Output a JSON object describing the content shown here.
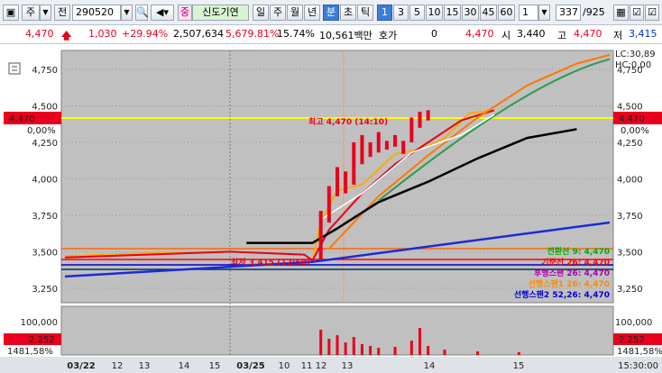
{
  "toolbar": {
    "market_label": "주",
    "jeon_label": "전",
    "stock_code": "290520",
    "stock_name": "신도기연",
    "stock_badge": "중",
    "period_tabs": [
      "일",
      "주",
      "월",
      "년",
      "분",
      "초",
      "틱"
    ],
    "selected_period": "분",
    "intervals": [
      "1",
      "3",
      "5",
      "10",
      "15",
      "30",
      "45",
      "60"
    ],
    "selected_interval": "1",
    "count_value": "1",
    "page_counter": "337",
    "page_total": "/925"
  },
  "quote": {
    "price": "4,470",
    "change": "1,030",
    "change_pct": "+29.94%",
    "volume": "2,507,634",
    "volume_pct": "5,679.81%",
    "turnover_pct": "15.74%",
    "amount": "10,561백만",
    "hoga_label": "호가",
    "hoga_value": "0",
    "hoga_price": "4,470",
    "open_label": "시",
    "open_value": "3,440",
    "high_label": "고",
    "high_value": "4,470",
    "low_label": "저",
    "low_value": "3,415"
  },
  "chart": {
    "lc_label": "LC:30,89",
    "hc_label": "HC:0,00",
    "price_ticks": [
      "4,750",
      "4,500",
      "4,250",
      "4,000",
      "3,750",
      "3,500",
      "3,250"
    ],
    "current_price_tag": "4,470",
    "current_pct_tag": "0,00%",
    "high_annotation": "최고 4,470 (14:10)",
    "low_annotation": "최저 3,415 (12:58)",
    "ichimoku_labels": [
      "전환선 9: 4,470",
      "기준선 26: 4,470",
      "후행스팬 26: 4,470",
      "선행스팬1 26: 4,470",
      "선행스팬2 52,26: 4,470"
    ],
    "volume_tick": "100,000",
    "volume_tag": "2,252",
    "volume_pct_tag": "1481,58%",
    "x_labels": [
      "03/22",
      "12",
      "13",
      "14",
      "15",
      "03/25",
      "10",
      "11",
      "12",
      "13",
      "14",
      "15"
    ],
    "time_label": "15:30:00"
  },
  "colors": {
    "up": "#e8001c",
    "down": "#0033cc",
    "chart_bg": "#c0c0c0",
    "highline": "#ffff00",
    "selected_tab": "#3b7dd8"
  },
  "chart_data": {
    "type": "line",
    "title": "",
    "xlabel": "",
    "ylabel": "",
    "ylim": [
      3150,
      4880
    ],
    "x_labels": [
      "03/22",
      "12",
      "13",
      "14",
      "15",
      "03/25",
      "10",
      "11",
      "12",
      "13",
      "14",
      "15"
    ],
    "series": [
      {
        "name": "전환선 9",
        "points": [
          [
            0,
            3470
          ],
          [
            10,
            3490
          ],
          [
            20,
            3500
          ],
          [
            29,
            3480
          ],
          [
            30,
            3440
          ],
          [
            31,
            3700
          ],
          [
            33,
            3920
          ],
          [
            36,
            3960
          ],
          [
            40,
            4170
          ],
          [
            43,
            4200
          ],
          [
            46,
            4280
          ],
          [
            49,
            4450
          ],
          [
            52,
            4470
          ]
        ]
      },
      {
        "name": "기준선 26",
        "points": [
          [
            0,
            3460
          ],
          [
            20,
            3500
          ],
          [
            29,
            3480
          ],
          [
            30,
            3440
          ],
          [
            32,
            3650
          ],
          [
            36,
            3900
          ],
          [
            40,
            4100
          ],
          [
            44,
            4250
          ],
          [
            48,
            4400
          ],
          [
            52,
            4470
          ]
        ]
      },
      {
        "name": "선행스팬1 26",
        "points": [
          [
            32,
            3520
          ],
          [
            38,
            3880
          ],
          [
            44,
            4160
          ],
          [
            50,
            4420
          ],
          [
            56,
            4640
          ],
          [
            62,
            4790
          ],
          [
            66,
            4850
          ]
        ]
      },
      {
        "name": "선행스팬2 52,26",
        "points": [
          [
            22,
            3560
          ],
          [
            29,
            3560
          ],
          [
            30,
            3560
          ],
          [
            33,
            3660
          ],
          [
            38,
            3840
          ],
          [
            44,
            3980
          ],
          [
            50,
            4140
          ],
          [
            56,
            4280
          ],
          [
            62,
            4340
          ]
        ]
      }
    ],
    "price_range": {
      "open": 3440,
      "high": 4470,
      "low": 3415,
      "close": 4470
    }
  }
}
